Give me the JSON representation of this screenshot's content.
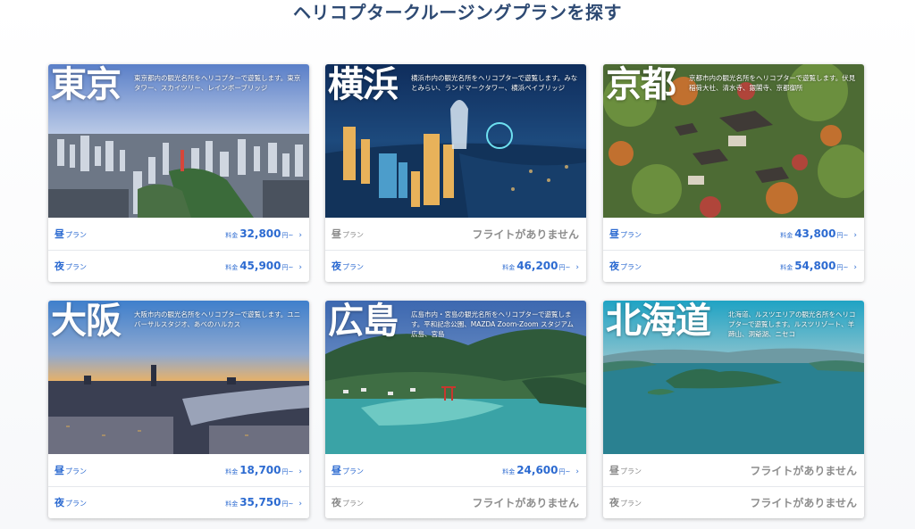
{
  "page": {
    "title": "ヘリコプタークルージングプランを探す"
  },
  "common": {
    "day_main": "昼",
    "day_sub": "プラン",
    "night_main": "夜",
    "night_sub": "プラン",
    "price_prefix": "料金",
    "price_suffix": "円~",
    "chevron": "›",
    "no_flight": "フライトがありません"
  },
  "cards": [
    {
      "city": "東京",
      "desc": "東京都内の観光名所をヘリコプターで遊覧します。東京タワー、スカイツリー、レインボーブリッジ",
      "day_price": "32,800",
      "night_price": "45,900"
    },
    {
      "city": "横浜",
      "desc": "横浜市内の観光名所をヘリコプターで遊覧します。みなとみらい、ランドマークタワー、横浜ベイブリッジ",
      "day_price": "",
      "night_price": "46,200"
    },
    {
      "city": "京都",
      "desc": "京都市内の観光名所をヘリコプターで遊覧します。伏見稲荷大社、清水寺、銀閣寺、京都御所",
      "day_price": "43,800",
      "night_price": "54,800"
    },
    {
      "city": "大阪",
      "desc": "大阪市内の観光名所をヘリコプターで遊覧します。ユニバーサルスタジオ、あべのハルカス",
      "day_price": "18,700",
      "night_price": "35,750"
    },
    {
      "city": "広島",
      "desc": "広島市内・宮島の観光名所をヘリコプターで遊覧します。平和記念公園、MAZDA Zoom-Zoom スタジアム 広島、宮島",
      "day_price": "24,600",
      "night_price": ""
    },
    {
      "city": "北海道",
      "desc": "北海道、ルスツエリアの観光名所をヘリコプターで遊覧します。ルスツリゾート、羊蹄山、洞爺湖、ニセコ",
      "day_price": "",
      "night_price": ""
    }
  ]
}
